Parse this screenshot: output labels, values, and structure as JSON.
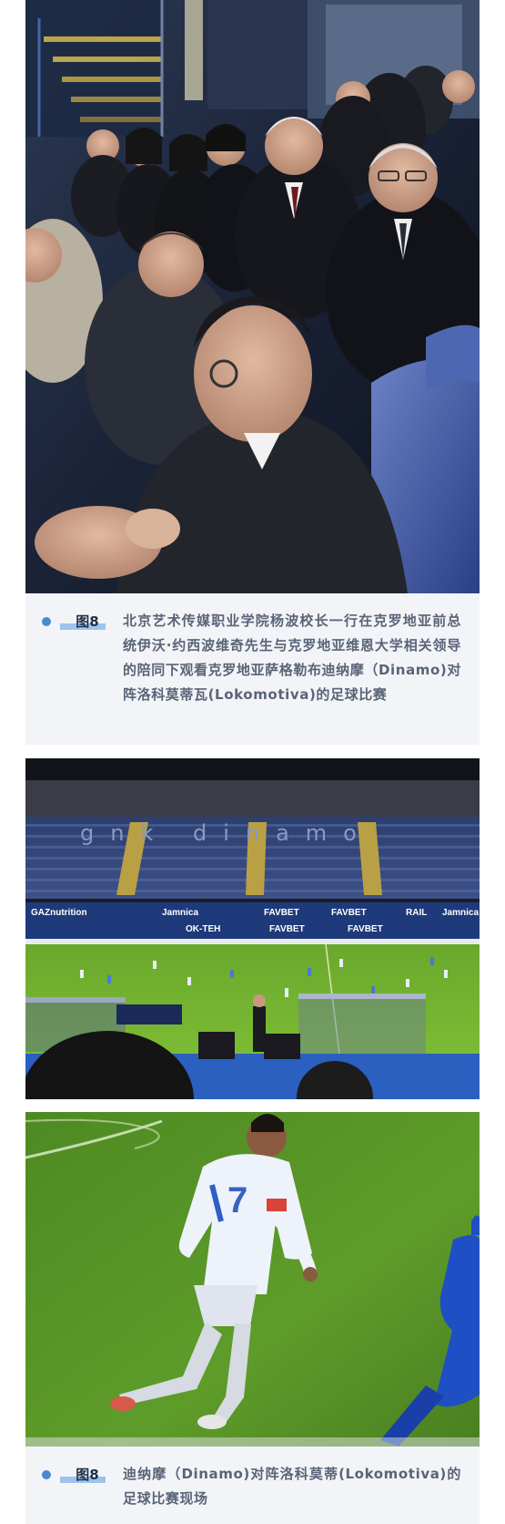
{
  "figures": [
    {
      "tag": "图8",
      "caption": "北京艺术传媒职业学院杨波校长一行在克罗地亚前总统伊沃·约西波维奇先生与克罗地亚维恩大学相关领导的陪同下观看克罗地亚萨格勒布迪纳摩（Dinamo)对阵洛科莫蒂瓦(Lokomotiva)的足球比赛"
    },
    {
      "tag": "图8",
      "caption": "迪纳摩（Dinamo)对阵洛科莫蒂(Lokomotiva)的足球比赛现场"
    }
  ],
  "stadium": {
    "stand_lettering": "gnk dinamo",
    "ads": [
      "GAZnutrition",
      "Jamnica",
      "FAVBET",
      "FAVBET",
      "RAIL",
      "OK-TEH",
      "FAVBET",
      "FAVBET",
      "Jamnica"
    ]
  },
  "colors": {
    "accent_dot": "#4a88d4",
    "accent_bar": "#9ec3ea",
    "caption_bg": "#f3f4f7",
    "caption_text": "#5a6478",
    "tag_text": "#1c2f4a"
  }
}
